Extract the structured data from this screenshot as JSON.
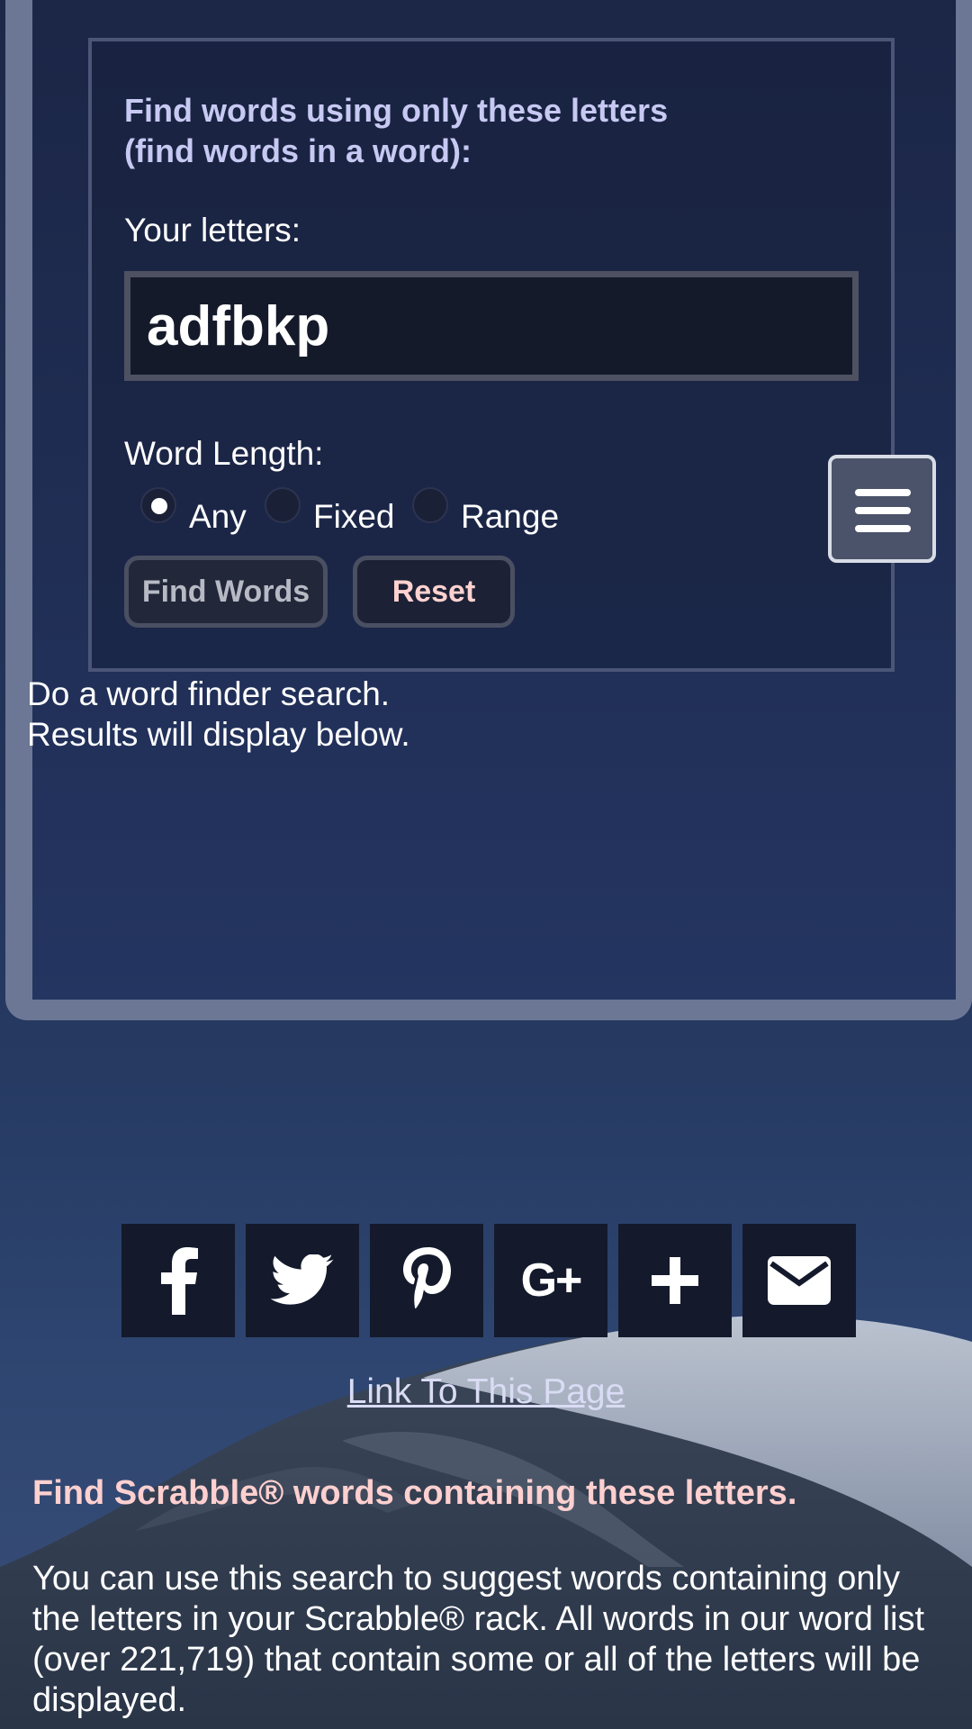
{
  "form": {
    "heading_line1": "Find words using only these letters",
    "heading_line2": "(find words in a word):",
    "letters_label": "Your letters:",
    "letters_value": "adfbkp",
    "word_length_label": "Word Length:",
    "length_options": [
      {
        "label": "Any",
        "selected": true
      },
      {
        "label": "Fixed",
        "selected": false
      },
      {
        "label": "Range",
        "selected": false
      }
    ],
    "find_button": "Find Words",
    "reset_button": "Reset"
  },
  "status": {
    "line1": "Do a word finder search.",
    "line2": "Results will display below."
  },
  "menu": {
    "icon": "hamburger-menu-icon"
  },
  "share": {
    "icons": [
      "facebook-icon",
      "twitter-icon",
      "pinterest-icon",
      "google-plus-icon",
      "plus-icon",
      "email-icon"
    ],
    "google_plus_text": "G+"
  },
  "link_to_page": "Link To This Page",
  "promo": {
    "heading": "Find Scrabble® words containing these letters.",
    "text": "You can use this search to suggest words containing only the letters in your Scrabble® rack. All words in our word list (over 221,719) that contain some or all of the letters will be displayed."
  },
  "colors": {
    "heading": "#c7c9f3",
    "promo_heading": "#ffd0cf",
    "reset_text": "#ffd2d0",
    "panel_border": "#6c7795"
  }
}
